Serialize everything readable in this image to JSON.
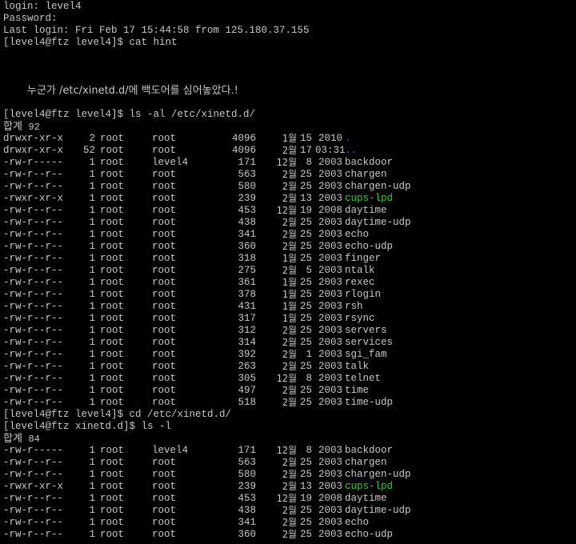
{
  "terminal": {
    "login_line": "login: level4",
    "password_line": "Password:",
    "last_login_line": "Last login: Fri Feb 17 15:44:58 from 125.180.37.155",
    "cmd_cat_hint": "[level4@ftz level4]$ cat hint",
    "hint_text": "누군가 /etc/xinetd.d/에 백도어를 심어놓았다.!",
    "cmd_ls_al": "[level4@ftz level4]$ ls -al /etc/xinetd.d/",
    "listing1_total_label": "합계",
    "listing1_total_value": "92",
    "listing1_rows": [
      {
        "perm": "drwxr-xr-x",
        "links": "2",
        "owner": "root",
        "group": "root",
        "size": "4096",
        "month": "1월",
        "day": "15",
        "year": "2010",
        "name": ".",
        "kind": "dir"
      },
      {
        "perm": "drwxr-xr-x",
        "links": "52",
        "owner": "root",
        "group": "root",
        "size": "4096",
        "month": "2월",
        "day": "17",
        "year": "03:31",
        "name": "..",
        "kind": "dir"
      },
      {
        "perm": "-rw-r-----",
        "links": "1",
        "owner": "root",
        "group": "level4",
        "size": "171",
        "month": "12월",
        "day": "8",
        "year": "2003",
        "name": "backdoor",
        "kind": "file"
      },
      {
        "perm": "-rw-r--r--",
        "links": "1",
        "owner": "root",
        "group": "root",
        "size": "563",
        "month": "2월",
        "day": "25",
        "year": "2003",
        "name": "chargen",
        "kind": "file"
      },
      {
        "perm": "-rw-r--r--",
        "links": "1",
        "owner": "root",
        "group": "root",
        "size": "580",
        "month": "2월",
        "day": "25",
        "year": "2003",
        "name": "chargen-udp",
        "kind": "file"
      },
      {
        "perm": "-rwxr-xr-x",
        "links": "1",
        "owner": "root",
        "group": "root",
        "size": "239",
        "month": "2월",
        "day": "13",
        "year": "2003",
        "name": "cups-lpd",
        "kind": "exec"
      },
      {
        "perm": "-rw-r--r--",
        "links": "1",
        "owner": "root",
        "group": "root",
        "size": "453",
        "month": "12월",
        "day": "19",
        "year": "2008",
        "name": "daytime",
        "kind": "file"
      },
      {
        "perm": "-rw-r--r--",
        "links": "1",
        "owner": "root",
        "group": "root",
        "size": "438",
        "month": "2월",
        "day": "25",
        "year": "2003",
        "name": "daytime-udp",
        "kind": "file"
      },
      {
        "perm": "-rw-r--r--",
        "links": "1",
        "owner": "root",
        "group": "root",
        "size": "341",
        "month": "2월",
        "day": "25",
        "year": "2003",
        "name": "echo",
        "kind": "file"
      },
      {
        "perm": "-rw-r--r--",
        "links": "1",
        "owner": "root",
        "group": "root",
        "size": "360",
        "month": "2월",
        "day": "25",
        "year": "2003",
        "name": "echo-udp",
        "kind": "file"
      },
      {
        "perm": "-rw-r--r--",
        "links": "1",
        "owner": "root",
        "group": "root",
        "size": "318",
        "month": "1월",
        "day": "25",
        "year": "2003",
        "name": "finger",
        "kind": "file"
      },
      {
        "perm": "-rw-r--r--",
        "links": "1",
        "owner": "root",
        "group": "root",
        "size": "275",
        "month": "2월",
        "day": "5",
        "year": "2003",
        "name": "ntalk",
        "kind": "file"
      },
      {
        "perm": "-rw-r--r--",
        "links": "1",
        "owner": "root",
        "group": "root",
        "size": "361",
        "month": "1월",
        "day": "25",
        "year": "2003",
        "name": "rexec",
        "kind": "file"
      },
      {
        "perm": "-rw-r--r--",
        "links": "1",
        "owner": "root",
        "group": "root",
        "size": "378",
        "month": "1월",
        "day": "25",
        "year": "2003",
        "name": "rlogin",
        "kind": "file"
      },
      {
        "perm": "-rw-r--r--",
        "links": "1",
        "owner": "root",
        "group": "root",
        "size": "431",
        "month": "1월",
        "day": "25",
        "year": "2003",
        "name": "rsh",
        "kind": "file"
      },
      {
        "perm": "-rw-r--r--",
        "links": "1",
        "owner": "root",
        "group": "root",
        "size": "317",
        "month": "1월",
        "day": "25",
        "year": "2003",
        "name": "rsync",
        "kind": "file"
      },
      {
        "perm": "-rw-r--r--",
        "links": "1",
        "owner": "root",
        "group": "root",
        "size": "312",
        "month": "2월",
        "day": "25",
        "year": "2003",
        "name": "servers",
        "kind": "file"
      },
      {
        "perm": "-rw-r--r--",
        "links": "1",
        "owner": "root",
        "group": "root",
        "size": "314",
        "month": "2월",
        "day": "25",
        "year": "2003",
        "name": "services",
        "kind": "file"
      },
      {
        "perm": "-rw-r--r--",
        "links": "1",
        "owner": "root",
        "group": "root",
        "size": "392",
        "month": "2월",
        "day": "1",
        "year": "2003",
        "name": "sgi_fam",
        "kind": "file"
      },
      {
        "perm": "-rw-r--r--",
        "links": "1",
        "owner": "root",
        "group": "root",
        "size": "263",
        "month": "2월",
        "day": "25",
        "year": "2003",
        "name": "talk",
        "kind": "file"
      },
      {
        "perm": "-rw-r--r--",
        "links": "1",
        "owner": "root",
        "group": "root",
        "size": "305",
        "month": "12월",
        "day": "8",
        "year": "2003",
        "name": "telnet",
        "kind": "file"
      },
      {
        "perm": "-rw-r--r--",
        "links": "1",
        "owner": "root",
        "group": "root",
        "size": "497",
        "month": "2월",
        "day": "25",
        "year": "2003",
        "name": "time",
        "kind": "file"
      },
      {
        "perm": "-rw-r--r--",
        "links": "1",
        "owner": "root",
        "group": "root",
        "size": "518",
        "month": "2월",
        "day": "25",
        "year": "2003",
        "name": "time-udp",
        "kind": "file"
      }
    ],
    "cmd_cd": "[level4@ftz level4]$ cd /etc/xinetd.d/",
    "cmd_ls_l": "[level4@ftz xinetd.d]$ ls -l",
    "listing2_total_label": "합계",
    "listing2_total_value": "84",
    "listing2_rows": [
      {
        "perm": "-rw-r-----",
        "links": "1",
        "owner": "root",
        "group": "level4",
        "size": "171",
        "month": "12월",
        "day": "8",
        "year": "2003",
        "name": "backdoor",
        "kind": "file"
      },
      {
        "perm": "-rw-r--r--",
        "links": "1",
        "owner": "root",
        "group": "root",
        "size": "563",
        "month": "2월",
        "day": "25",
        "year": "2003",
        "name": "chargen",
        "kind": "file"
      },
      {
        "perm": "-rw-r--r--",
        "links": "1",
        "owner": "root",
        "group": "root",
        "size": "580",
        "month": "2월",
        "day": "25",
        "year": "2003",
        "name": "chargen-udp",
        "kind": "file"
      },
      {
        "perm": "-rwxr-xr-x",
        "links": "1",
        "owner": "root",
        "group": "root",
        "size": "239",
        "month": "2월",
        "day": "13",
        "year": "2003",
        "name": "cups-lpd",
        "kind": "exec"
      },
      {
        "perm": "-rw-r--r--",
        "links": "1",
        "owner": "root",
        "group": "root",
        "size": "453",
        "month": "12월",
        "day": "19",
        "year": "2008",
        "name": "daytime",
        "kind": "file"
      },
      {
        "perm": "-rw-r--r--",
        "links": "1",
        "owner": "root",
        "group": "root",
        "size": "438",
        "month": "2월",
        "day": "25",
        "year": "2003",
        "name": "daytime-udp",
        "kind": "file"
      },
      {
        "perm": "-rw-r--r--",
        "links": "1",
        "owner": "root",
        "group": "root",
        "size": "341",
        "month": "2월",
        "day": "25",
        "year": "2003",
        "name": "echo",
        "kind": "file"
      },
      {
        "perm": "-rw-r--r--",
        "links": "1",
        "owner": "root",
        "group": "root",
        "size": "360",
        "month": "2월",
        "day": "25",
        "year": "2003",
        "name": "echo-udp",
        "kind": "file"
      }
    ],
    "colors": {
      "background": "#000000",
      "text": "#c8c8c8",
      "directory": "#2a3cd8",
      "executable": "#37c62b"
    }
  }
}
